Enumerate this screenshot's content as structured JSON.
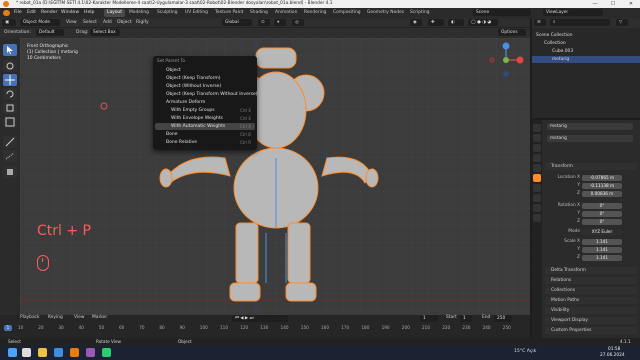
{
  "window": {
    "title": "* robot_01a [D:\\EĞİTİM SETİ 4.1\\02-Karakter Modelleme-4 saat\\2-Uygulamalar-3 saat\\02-Robot\\02-Blender dosyaları\\robot_01a.blend] - Blender 4.1",
    "min": "—",
    "max": "☐",
    "close": "✕"
  },
  "menubar": {
    "items": [
      "File",
      "Edit",
      "Render",
      "Window",
      "Help"
    ],
    "workspaces": [
      "Layout",
      "Modeling",
      "Sculpting",
      "UV Editing",
      "Texture Paint",
      "Shading",
      "Animation",
      "Rendering",
      "Compositing",
      "Geometry Nodes",
      "Scripting"
    ],
    "active_workspace": "Layout",
    "scene_label": "Scene",
    "viewlayer_label": "ViewLayer"
  },
  "header": {
    "mode": "Object Mode",
    "menus": [
      "View",
      "Select",
      "Add",
      "Object",
      "Rigify"
    ],
    "orientation_label": "Orientation:",
    "orientation_value": "Default",
    "drag_label": "Drag:",
    "drag_value": "Select Box",
    "transform_space": "Global",
    "options_label": "Options"
  },
  "viewport": {
    "info": [
      "Front Orthographic",
      "(1) Collection | metarig",
      "10 Centimeters"
    ],
    "overlay_text": "Ctrl + P"
  },
  "context_menu": {
    "title": "Set Parent To",
    "items": [
      {
        "label": "Object",
        "shortcut": "",
        "sub": false,
        "highlight": false
      },
      {
        "label": "Object (Keep Transform)",
        "shortcut": "",
        "sub": false,
        "highlight": false
      },
      {
        "label": "Object (Without Inverse)",
        "shortcut": "",
        "sub": false,
        "highlight": false
      },
      {
        "label": "Object (Keep Transform Without Inverse)",
        "shortcut": "",
        "sub": false,
        "highlight": false
      },
      {
        "label": "Armature Deform",
        "shortcut": "",
        "sub": false,
        "highlight": false
      },
      {
        "label": "With Empty Groups",
        "shortcut": "Ctrl E",
        "sub": true,
        "highlight": false
      },
      {
        "label": "With Envelope Weights",
        "shortcut": "Ctrl E",
        "sub": true,
        "highlight": false
      },
      {
        "label": "With Automatic Weights",
        "shortcut": "Ctrl A",
        "sub": true,
        "highlight": true
      },
      {
        "label": "Bone",
        "shortcut": "Ctrl B",
        "sub": false,
        "highlight": false
      },
      {
        "label": "Bone Relative",
        "shortcut": "Ctrl R",
        "sub": false,
        "highlight": false
      }
    ]
  },
  "outliner": {
    "rows": [
      {
        "label": "Scene Collection",
        "indent": 0,
        "selected": false
      },
      {
        "label": "Collection",
        "indent": 1,
        "selected": false
      },
      {
        "label": "Cube.003",
        "indent": 2,
        "selected": false
      },
      {
        "label": "metarig",
        "indent": 2,
        "selected": true
      }
    ]
  },
  "properties": {
    "object_name": "metarig",
    "sections": {
      "transform": "Transform",
      "delta": "Delta Transform",
      "relations": "Relations",
      "collections": "Collections",
      "motion_paths": "Motion Paths",
      "visibility": "Visibility",
      "viewport_display": "Viewport Display",
      "custom_props": "Custom Properties"
    },
    "location_label": "Location X",
    "location": [
      "-0.07865 m",
      "-0.11138 m",
      "0.00836 m"
    ],
    "rotation_label": "Rotation X",
    "rotation": [
      "0°",
      "0°",
      "0°"
    ],
    "mode_label": "Mode",
    "mode_value": "XYZ Euler",
    "scale_label": "Scale X",
    "scale": [
      "1.141",
      "1.141",
      "1.141"
    ],
    "axes": [
      "X",
      "Y",
      "Z"
    ]
  },
  "timeline": {
    "menus": [
      "Playback",
      "Keying",
      "View",
      "Marker"
    ],
    "current_frame": "1",
    "start_label": "Start",
    "start": "1",
    "end_label": "End",
    "end": "250",
    "ticks": [
      "10",
      "20",
      "30",
      "40",
      "50",
      "60",
      "70",
      "80",
      "90",
      "100",
      "110",
      "120",
      "130",
      "140",
      "150",
      "160",
      "170",
      "180",
      "190",
      "200",
      "210",
      "220",
      "230",
      "240",
      "250"
    ]
  },
  "statusbar": {
    "left": "Select",
    "mid": "Rotate View",
    "right": "Object",
    "version": "4.1.1"
  },
  "taskbar": {
    "weather": "15°C Açık",
    "time": "01:58",
    "date": "27.06.2024"
  },
  "colors": {
    "accent": "#4772b3",
    "orange": "#ff8c2a",
    "overlay_red": "#ff5a5a"
  }
}
